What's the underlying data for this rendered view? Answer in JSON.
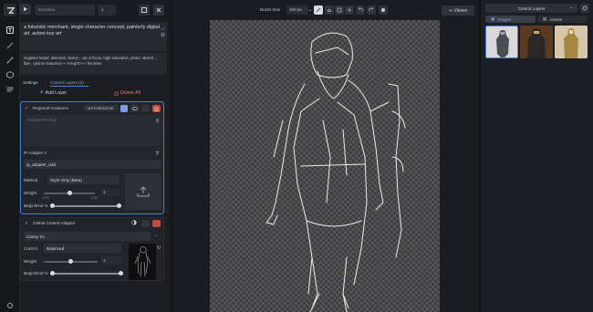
{
  "toolbar": {
    "model_select": "Breakhul",
    "image_count": "1",
    "brush_size_label": "Brush Size",
    "brush_size_value": "100 px",
    "viewer_label": "Viewer"
  },
  "prompts": {
    "positive": "a futuristic merchant, single character concept, painterly digital art, action key art",
    "negative": "negative faded, distorted, blurry+, out of focus, high saturation, photo, sketch, , flat+, (anime features)++ <HegiTi>++ feminine"
  },
  "tabs": {
    "settings": "Settings",
    "control_layers": "Control Layers (2)"
  },
  "layer_actions": {
    "add": "Add Layer",
    "delete_all": "Delete All"
  },
  "regional": {
    "title": "Regional Guidance",
    "auto_negative": "AUTO NEGATIVE",
    "prompt_placeholder": "Positive Prompt",
    "ip_adapter_label": "IP Adapter 1",
    "ip_adapter_model": "ip_adapter_sdxl",
    "method_label": "Method",
    "method_value": "Style Only (Beta)",
    "weight_label": "Weight",
    "weight_value": "1",
    "weight_fraction": 0.5,
    "weight_min": "0.00",
    "weight_max": "2.00",
    "begin_end_label": "Begin/End %"
  },
  "global_control": {
    "title": "Global Control Adapter",
    "model": "Canny XL",
    "control_label": "Control",
    "control_value": "Balanced",
    "weight_label": "Weight",
    "weight_value": "1",
    "weight_fraction": 0.5,
    "begin_end_label": "Begin/End %"
  },
  "right_panel": {
    "dropdown": "Control Layers",
    "tab_images": "Images",
    "tab_assets": "Assets"
  },
  "colors": {
    "accent": "#4f7fd2",
    "danger": "#c8463f",
    "bg": "#15161a",
    "panel": "#1d1e23"
  },
  "icons": [
    "logo-icon",
    "text-icon",
    "brush-icon",
    "nodes-icon",
    "models-icon",
    "queue-icon",
    "settings-icon",
    "upload-icon",
    "trash-icon",
    "eye-icon",
    "lock-icon",
    "undo-icon",
    "redo-icon",
    "plus-icon",
    "grid-icon"
  ]
}
